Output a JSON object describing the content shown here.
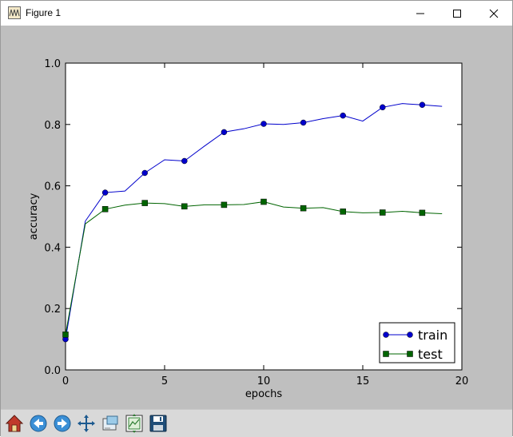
{
  "window": {
    "title": "Figure 1"
  },
  "toolbar": {
    "buttons": [
      {
        "icon": "home-icon"
      },
      {
        "icon": "back-arrow-icon"
      },
      {
        "icon": "forward-arrow-icon"
      },
      {
        "icon": "pan-icon"
      },
      {
        "icon": "zoom-rect-icon"
      },
      {
        "icon": "subplots-config-icon"
      },
      {
        "icon": "save-icon"
      }
    ]
  },
  "chart_data": {
    "type": "line",
    "title": "",
    "xlabel": "epochs",
    "ylabel": "accuracy",
    "xlim": [
      0,
      20
    ],
    "ylim": [
      0.0,
      1.0
    ],
    "xticks": [
      "0",
      "5",
      "10",
      "15",
      "20"
    ],
    "yticks": [
      "0.0",
      "0.2",
      "0.4",
      "0.6",
      "0.8",
      "1.0"
    ],
    "legend_position": "lower-right",
    "x": [
      0,
      1,
      2,
      3,
      4,
      5,
      6,
      7,
      8,
      9,
      10,
      11,
      12,
      13,
      14,
      15,
      16,
      17,
      18,
      19
    ],
    "series": [
      {
        "name": "train",
        "color": "#0000cc",
        "marker": "circle",
        "values": [
          0.1,
          0.485,
          0.578,
          0.583,
          0.642,
          0.685,
          0.681,
          0.729,
          0.775,
          0.786,
          0.802,
          0.8,
          0.806,
          0.819,
          0.829,
          0.811,
          0.856,
          0.868,
          0.864,
          0.859
        ]
      },
      {
        "name": "test",
        "color": "#006400",
        "marker": "square",
        "values": [
          0.115,
          0.476,
          0.524,
          0.537,
          0.544,
          0.542,
          0.533,
          0.538,
          0.538,
          0.539,
          0.548,
          0.531,
          0.527,
          0.529,
          0.516,
          0.512,
          0.513,
          0.517,
          0.512,
          0.509
        ]
      }
    ]
  }
}
